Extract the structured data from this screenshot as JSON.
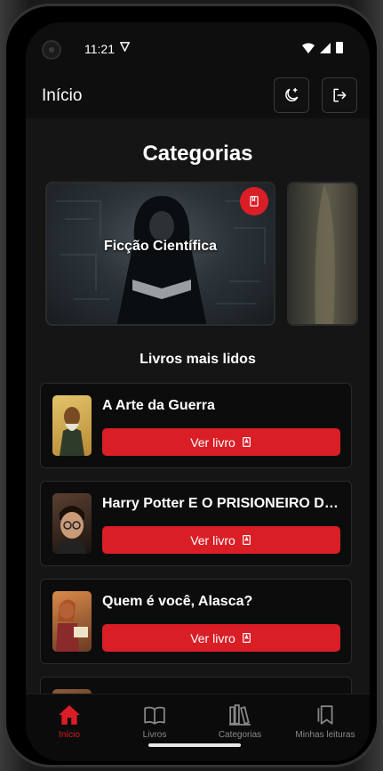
{
  "status_bar": {
    "time": "11:21"
  },
  "app_bar": {
    "title": "Início",
    "theme_toggle": "moon-plus-icon",
    "logout": "logout-icon"
  },
  "categories": {
    "title": "Categorias",
    "items": [
      {
        "name": "Ficção Científica",
        "icon": "book-icon"
      },
      {
        "name": ""
      }
    ]
  },
  "most_read": {
    "title": "Livros mais lidos",
    "button_label": "Ver livro",
    "books": [
      {
        "title": "A Arte da Guerra",
        "cover_color": "#c9a24a"
      },
      {
        "title": "Harry Potter E O PRISIONEIRO DE AZKABAN",
        "cover_color": "#3a2a24"
      },
      {
        "title": "Quem é você, Alasca?",
        "cover_color": "#b3572b"
      },
      {
        "title": "",
        "cover_color": "#6a4a32"
      }
    ]
  },
  "bottom_nav": [
    {
      "label": "Início",
      "icon": "home-icon",
      "active": true
    },
    {
      "label": "Livros",
      "icon": "open-book-icon",
      "active": false
    },
    {
      "label": "Categorias",
      "icon": "library-icon",
      "active": false
    },
    {
      "label": "Minhas leituras",
      "icon": "bookmark-icon",
      "active": false
    }
  ],
  "colors": {
    "accent": "#d91e26",
    "background": "#151515",
    "card": "#0c0c0c"
  }
}
